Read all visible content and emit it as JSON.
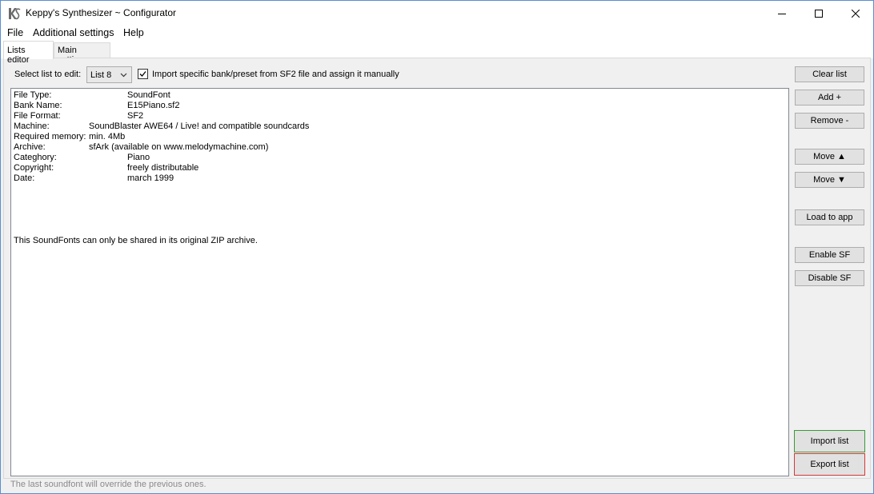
{
  "window": {
    "title": "Keppy's Synthesizer ~ Configurator"
  },
  "menu": {
    "items": [
      "File",
      "Additional settings",
      "Help"
    ]
  },
  "tabs": [
    {
      "label": "Lists editor",
      "active": true
    },
    {
      "label": "Main settings",
      "active": false
    }
  ],
  "editor": {
    "select_label": "Select list to edit:",
    "selected_list": "List 8",
    "import_checkbox_label": "Import specific bank/preset from SF2 file and assign it manually",
    "import_checked": true
  },
  "info_rows": [
    {
      "key": "File Type:",
      "value": "SoundFont"
    },
    {
      "key": "Bank Name:",
      "value": "E15Piano.sf2"
    },
    {
      "key": "File Format:",
      "value": "SF2"
    },
    {
      "key": "Machine:",
      "value": "SoundBlaster AWE64 / Live! and compatible soundcards"
    },
    {
      "key": "Required memory:",
      "value": "min. 4Mb"
    },
    {
      "key": "Archive:",
      "value": "sfArk (available on www.melodymachine.com)"
    },
    {
      "key": "Categhory:",
      "value": "Piano"
    },
    {
      "key": "Copyright:",
      "value": "freely distributable"
    },
    {
      "key": "Date:",
      "value": "march 1999"
    }
  ],
  "info_note": "This SoundFonts can only be shared in its original ZIP archive.",
  "buttons": {
    "clear_list": "Clear list",
    "add": "Add +",
    "remove": "Remove -",
    "move_up": "Move ▲",
    "move_down": "Move ▼",
    "load_to_app": "Load to app",
    "enable_sf": "Enable SF",
    "disable_sf": "Disable SF",
    "import_list": "Import list",
    "export_list": "Export list"
  },
  "status_text": "The last soundfont will override the previous ones.",
  "colors": {
    "import_border": "#3a9a3a",
    "export_border": "#d23a3a"
  }
}
